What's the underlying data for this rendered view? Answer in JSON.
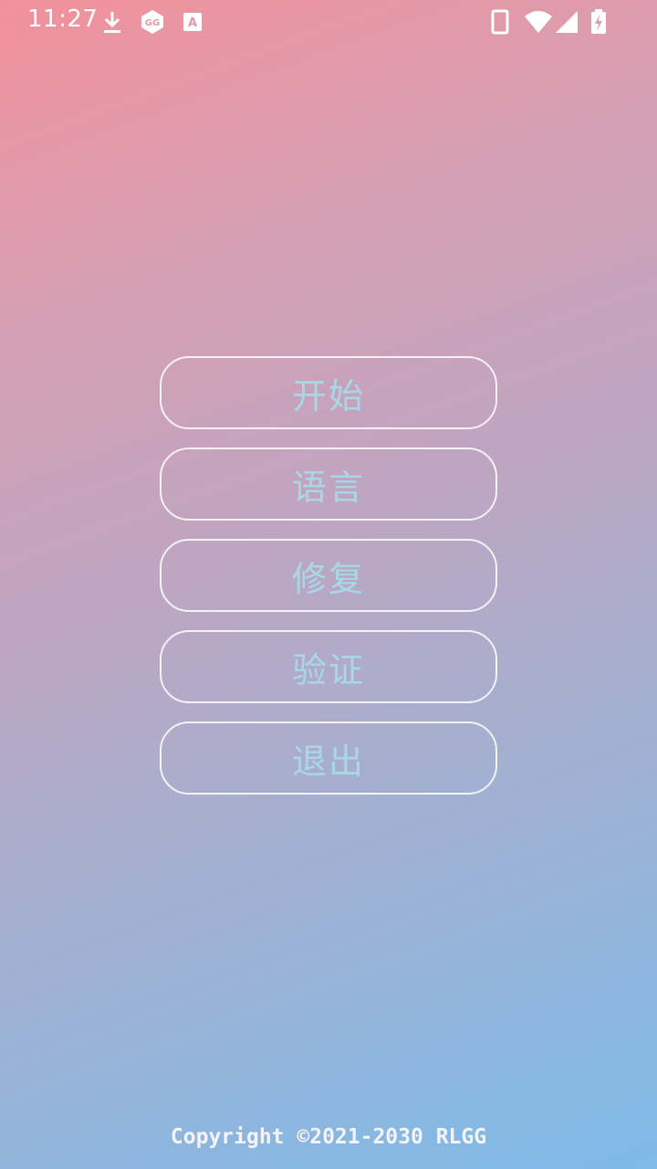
{
  "status_bar": {
    "time": "11:27",
    "left_icons": [
      "download-icon",
      "gg-app-icon",
      "font-a-icon"
    ],
    "right_icons": [
      "phone-icon",
      "wifi-icon",
      "signal-icon",
      "battery-charging-icon"
    ]
  },
  "menu": {
    "buttons": [
      {
        "label": "开始"
      },
      {
        "label": "语言"
      },
      {
        "label": "修复"
      },
      {
        "label": "验证"
      },
      {
        "label": "退出"
      }
    ]
  },
  "footer": {
    "copyright": "Copyright ©2021-2030 RLGG"
  },
  "colors": {
    "gradient_top_left": "#f2919b",
    "gradient_bottom_right": "#7dbbe8",
    "button_text": "#a8d8e6",
    "button_border": "#ffffff"
  }
}
